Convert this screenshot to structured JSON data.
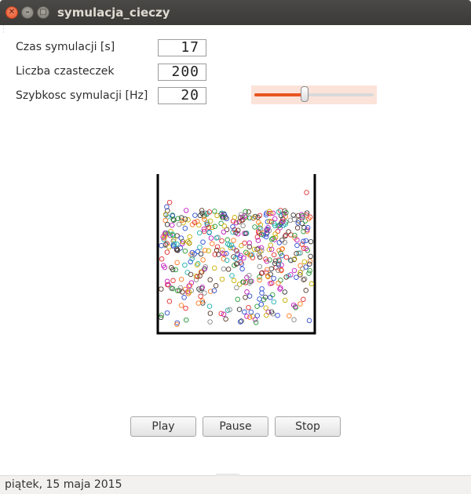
{
  "window": {
    "title": "symulacja_cieczy"
  },
  "form": {
    "time_label": "Czas symulacji [s]",
    "time_value": "17",
    "count_label": "Liczba czasteczek",
    "count_value": "200",
    "speed_label": "Szybkosc symulacji [Hz]",
    "speed_value": "20",
    "speed_slider_fraction": 0.42
  },
  "buttons": {
    "play": "Play",
    "pause": "Pause",
    "stop": "Stop"
  },
  "status": {
    "date": "piątek, 15 maja 2015"
  },
  "colors": {
    "accent": "#e95420",
    "particles": [
      "#3a3a3a",
      "#e03030",
      "#2a9a3a",
      "#3050d0",
      "#c020c0",
      "#20b0b0",
      "#c8b000",
      "#5a3a2a",
      "#ff7a20",
      "#8a8a8a"
    ]
  }
}
